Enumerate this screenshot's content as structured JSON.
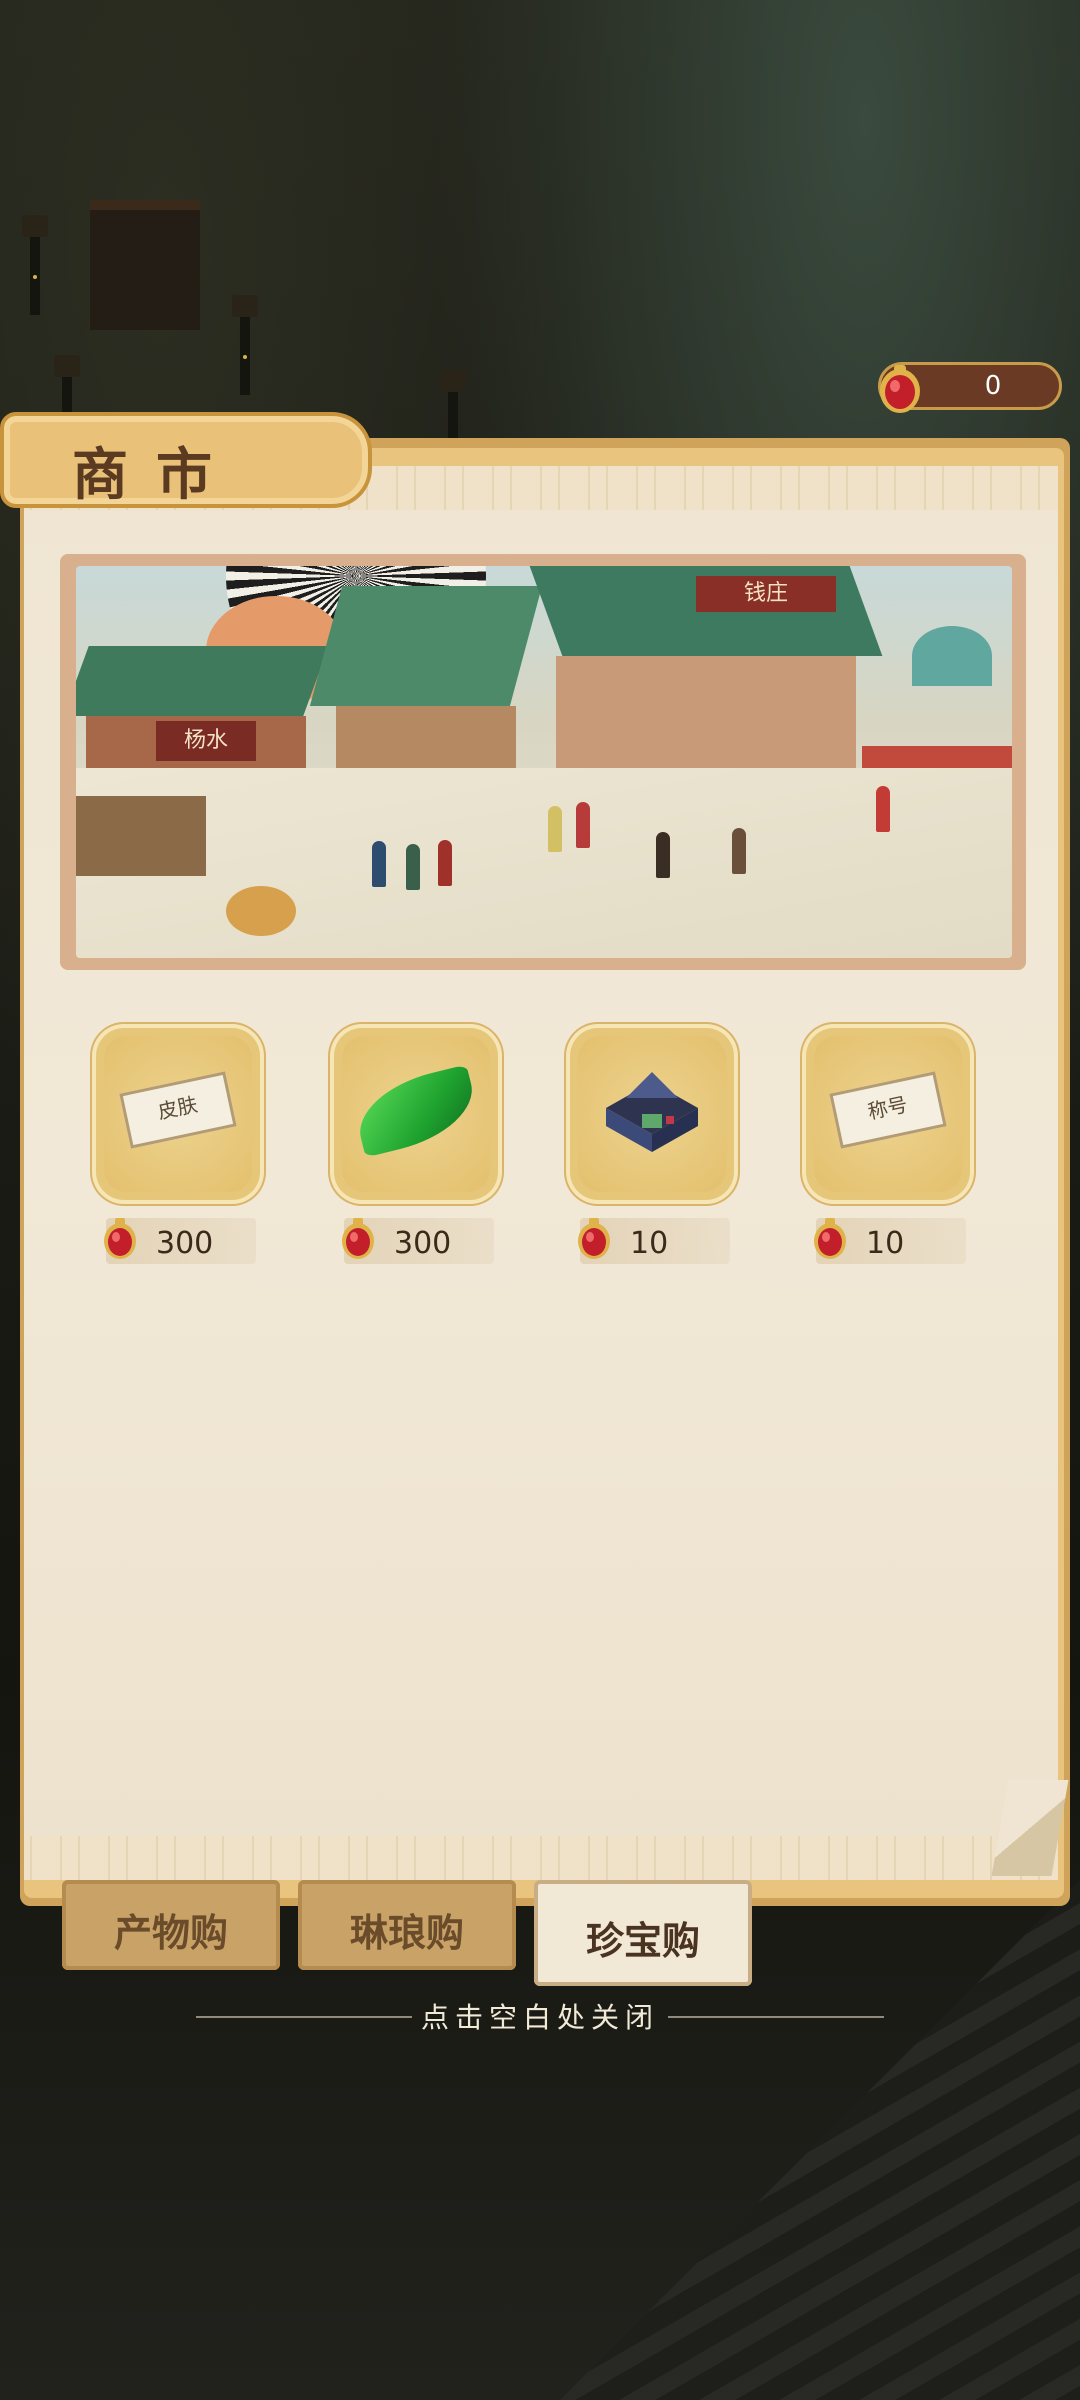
{
  "currency": {
    "amount": "0",
    "icon": "red-gem-icon"
  },
  "panel": {
    "title": "商市"
  },
  "banner": {
    "image": "market-street-illustration"
  },
  "banner_signs": [
    "杨水",
    "钱庄"
  ],
  "items": [
    {
      "icon": "ticket-icon",
      "ticket_text": "皮肤",
      "price": "300",
      "currency_icon": "red-gem-icon"
    },
    {
      "icon": "green-leaf-icon",
      "price": "300",
      "currency_icon": "red-gem-icon"
    },
    {
      "icon": "building-icon",
      "price": "10",
      "currency_icon": "red-gem-icon"
    },
    {
      "icon": "ticket-icon",
      "ticket_text": "称号",
      "price": "10",
      "currency_icon": "red-gem-icon"
    }
  ],
  "tabs": [
    {
      "label": "产物购",
      "active": false
    },
    {
      "label": "琳琅购",
      "active": false
    },
    {
      "label": "珍宝购",
      "active": true
    }
  ],
  "hint": "点击空白处关闭",
  "colors": {
    "gem": "#c21f2b",
    "panel_gold": "#e8c47e",
    "paper": "#efe5d2"
  }
}
